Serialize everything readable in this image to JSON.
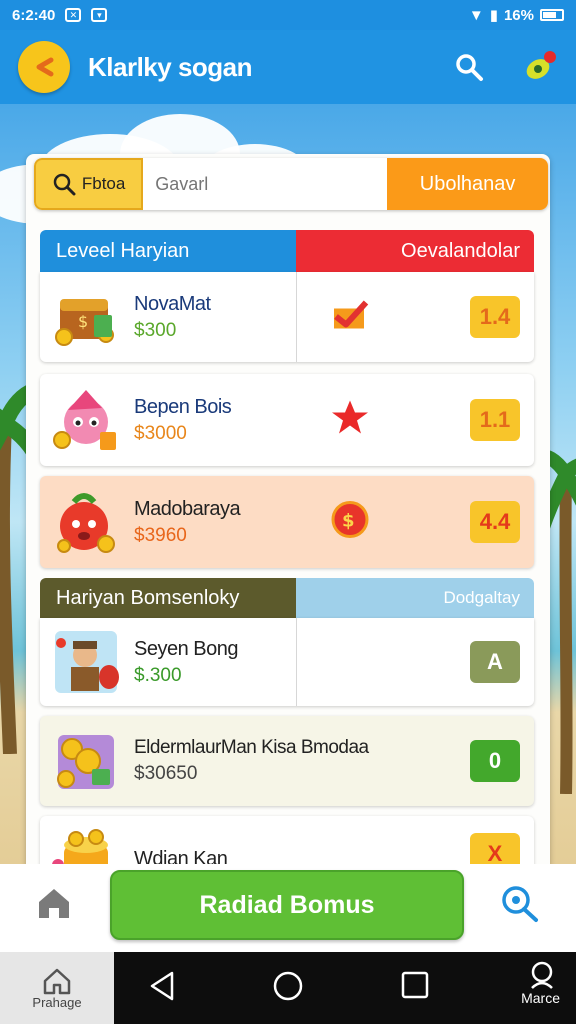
{
  "status": {
    "time": "6:2:40",
    "battery": "16%"
  },
  "appbar": {
    "title": "Klarlky sogan"
  },
  "search": {
    "tag_label": "Fbtoa",
    "placeholder": "Gavarl",
    "button_label": "Ubolhanav"
  },
  "section1": {
    "title": "Leveel Haryian",
    "right": "Oevalandolar"
  },
  "section2": {
    "title": "Hariyan Bomsenloky",
    "right": "Dodgaltay"
  },
  "items": [
    {
      "name": "NovaMat",
      "price": "$300",
      "badge": "1.4"
    },
    {
      "name": "Bepen Bois",
      "price": "$3000",
      "badge": "1.1"
    },
    {
      "name": "Madobaraya",
      "price": "$3960",
      "badge": "4.4"
    },
    {
      "name": "Seyen Bong",
      "price": "$.300",
      "badge": "A"
    },
    {
      "name": "EldermlaurMan Kisa Bmodaa",
      "price": "$30650",
      "badge": "0"
    },
    {
      "name": "Wdian Kan",
      "price": "",
      "badge": "X"
    }
  ],
  "bottom": {
    "cta_label": "Radiad Bomus"
  },
  "sysnav": {
    "home_label": "Prahage",
    "search_label": "Marce"
  },
  "colors": {
    "primary": "#2093e2",
    "accent": "#f7c51b",
    "cta": "#5fbf35",
    "red": "#ee2a2a"
  }
}
